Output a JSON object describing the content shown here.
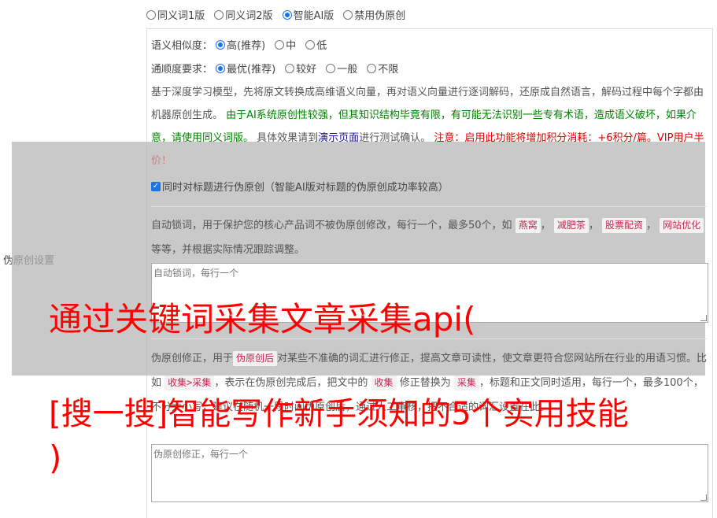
{
  "mode": {
    "options": [
      "同义词1版",
      "同义词2版",
      "智能AI版",
      "禁用伪原创"
    ],
    "selected_index": 2
  },
  "similarity": {
    "label": "语义相似度：",
    "options": [
      "高(推荐)",
      "中",
      "低"
    ],
    "selected_index": 0
  },
  "fluency": {
    "label": "通顺度要求：",
    "options": [
      "最优(推荐)",
      "较好",
      "一般",
      "不限"
    ],
    "selected_index": 0
  },
  "description": {
    "part1": "基于深度学习模型，先将原文转换成高维语义向量，再对语义向量进行逐词解码，还原成自然语言，解码过程中每个字都由机器原创生成。",
    "part2_green": "由于AI系统原创性较强，但其知识结构毕竟有限，有可能无法识别一些专有术语，造成语义破坏，如果介意，请使用同义词版。",
    "part3": "具体效果请到",
    "link": "演示页面",
    "part4": "进行测试确认。",
    "part5_red": "注意：启用此功能将增加积分消耗：+6积分/篇。VIP用户半价！"
  },
  "title_checkbox": {
    "label": "同时对标题进行伪原创（智能AI版对标题的伪原创成功率较高）",
    "checked": true
  },
  "side_label": "伪原创设置",
  "lock_words": {
    "desc_prefix": "自动锁词，用于保护您的核心产品词不被伪原创修改，每行一个，最多50个，如",
    "tags": [
      "燕窝",
      "减肥茶",
      "股票配资",
      "网站优化"
    ],
    "desc_suffix": "等等，并根据实际情况跟踪调整。",
    "placeholder": "自动锁词，每行一个"
  },
  "correction": {
    "text1": "伪原创修正，用于",
    "tag1": "伪原创后",
    "text2": "对某些不准确的词汇进行修正，提高文章可读性，使文章更符合您网站所在行业的用语习惯。比如",
    "tag2": "收集>采集",
    "text3": "，表示在伪原创完成后，把文中的",
    "tag3": "收集",
    "text4": "修正替换为",
    "tag4": "采集",
    "text5": "，标题和正文同时适用，每行一个，最多100个，不分大小写，建议在随机一段时间伪原创后，通过人工审核，把不合适的词汇设置在此。",
    "placeholder": "伪原创修正，每行一个"
  },
  "watermark": {
    "line1": "通过关键词采集文章采集api(",
    "line2": "[搜一搜]智能写作新手须知的5个实用技能",
    "line3": ")",
    "color": "#ff0000"
  }
}
